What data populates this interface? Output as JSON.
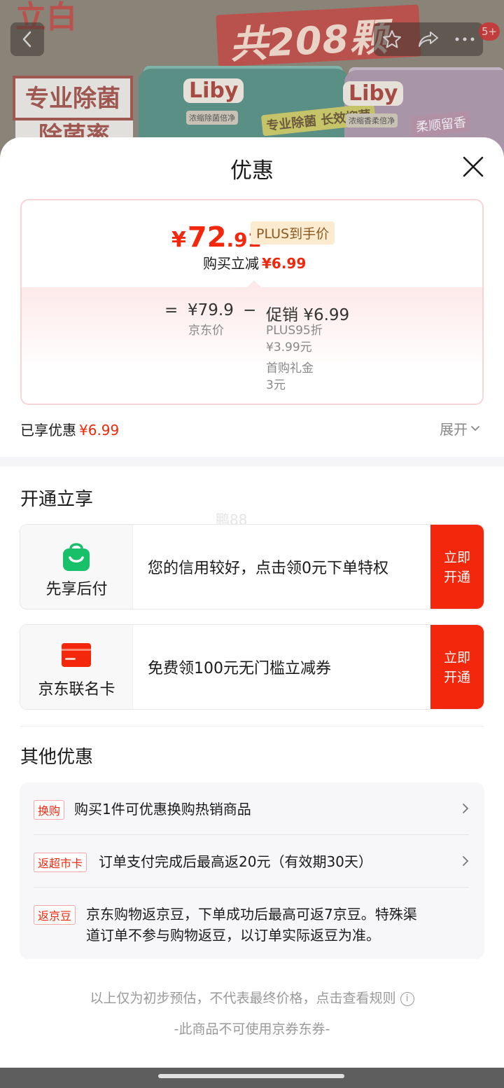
{
  "background": {
    "brand_top": "立白",
    "promo_text": "共208颗",
    "badge_line1": "专业除菌",
    "badge_line2": "除菌率",
    "brand_logo": "Liby",
    "brand_logo_cn": "立白",
    "box1_sub": "浓缩除菌倍净",
    "box1_label": "专业除菌 长效抑菌",
    "box2_sub": "浓缩香柔倍净",
    "box2_label": "柔顺留香",
    "notification_count": "5+"
  },
  "sheet": {
    "title": "优惠",
    "price_card": {
      "currency": "¥",
      "price_int": "72",
      "price_dec": ".91",
      "plus_tag": "PLUS到手价",
      "buy_reduce_label": "购买立减",
      "buy_reduce_amount": "¥6.99",
      "eq_sign": "=",
      "jd_price": "¥79.9",
      "jd_price_label": "京东价",
      "minus_sign": "−",
      "promo_label": "促销 ¥6.99",
      "promo_item1_name": "PLUS95折",
      "promo_item1_value": "¥3.99元",
      "promo_item2_name": "首购礼金",
      "promo_item2_value": "3元"
    },
    "enjoyed_label": "已享优惠",
    "enjoyed_amount": "¥6.99",
    "expand_label": "展开",
    "open_section_title": "开通立享",
    "watermark": "鹏88",
    "offers": [
      {
        "name": "先享后付",
        "desc": "您的信用较好，点击领0元下单特权",
        "cta_l1": "立即",
        "cta_l2": "开通"
      },
      {
        "name": "京东联名卡",
        "desc": "免费领100元无门槛立减券",
        "cta_l1": "立即",
        "cta_l2": "开通"
      }
    ],
    "other_section_title": "其他优惠",
    "other_offers": [
      {
        "tag": "换购",
        "text": "购买1件可优惠换购热销商品"
      },
      {
        "tag": "返超市卡",
        "text": "订单支付完成后最高返20元（有效期30天）"
      },
      {
        "tag": "返京豆",
        "text_l1": "京东购物返京豆，下单成功后最高可返7京豆。特殊渠",
        "text_l2": "道订单不参与购物返豆，以订单实际返豆为准。"
      }
    ],
    "disclaimer": "以上仅为初步预估，不代表最终价格，点击查看规则",
    "info_glyph": "i",
    "no_coupon": "-此商品不可使用京券东券-"
  },
  "colors": {
    "accent_red": "#f2270c",
    "plus_gold_bg": "#fdebcf",
    "app_green": "#18c06a"
  }
}
